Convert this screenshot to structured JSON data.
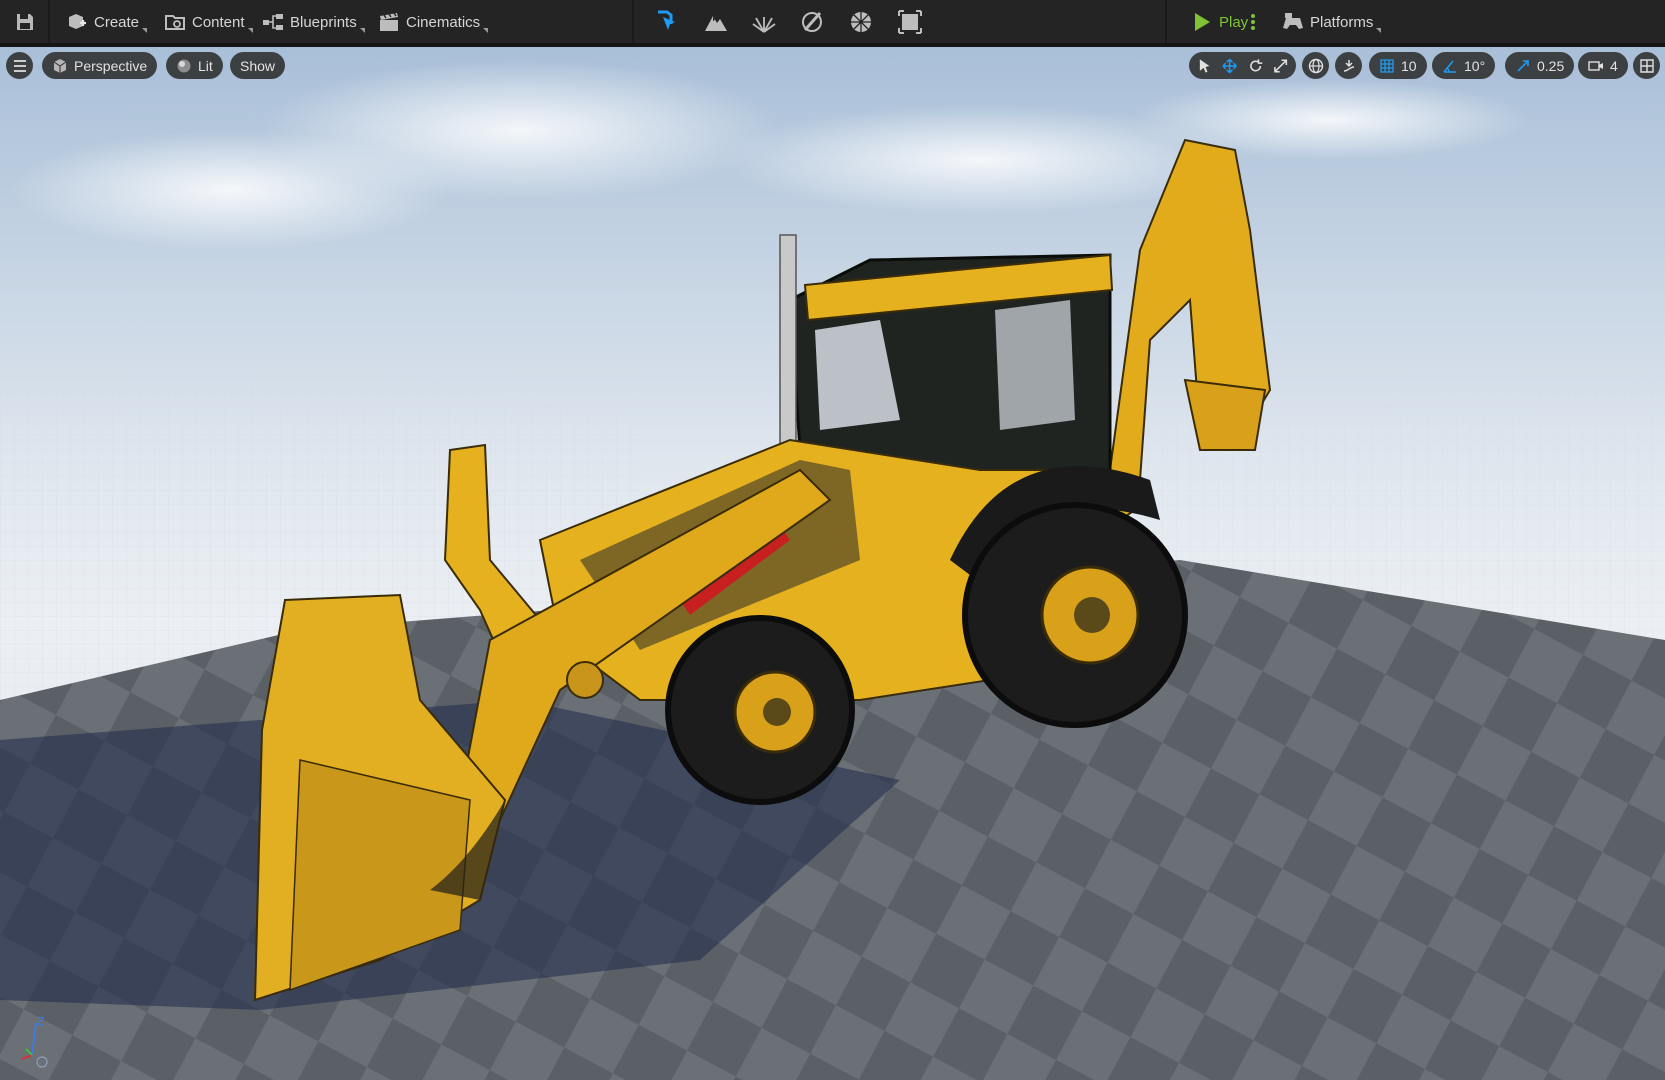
{
  "toolbar": {
    "create_label": "Create",
    "content_label": "Content",
    "blueprints_label": "Blueprints",
    "cinematics_label": "Cinematics",
    "play_label": "Play",
    "platforms_label": "Platforms"
  },
  "viewport": {
    "view_mode_label": "Perspective",
    "lighting_label": "Lit",
    "show_label": "Show",
    "grid_snap_value": "10",
    "rotation_snap_value": "10°",
    "scale_snap_value": "0.25",
    "camera_speed_value": "4"
  },
  "colors": {
    "accent_blue": "#1e9bf0",
    "play_green": "#7fc234",
    "toolbar_bg": "#242424",
    "loader_yellow": "#e5b11f"
  }
}
